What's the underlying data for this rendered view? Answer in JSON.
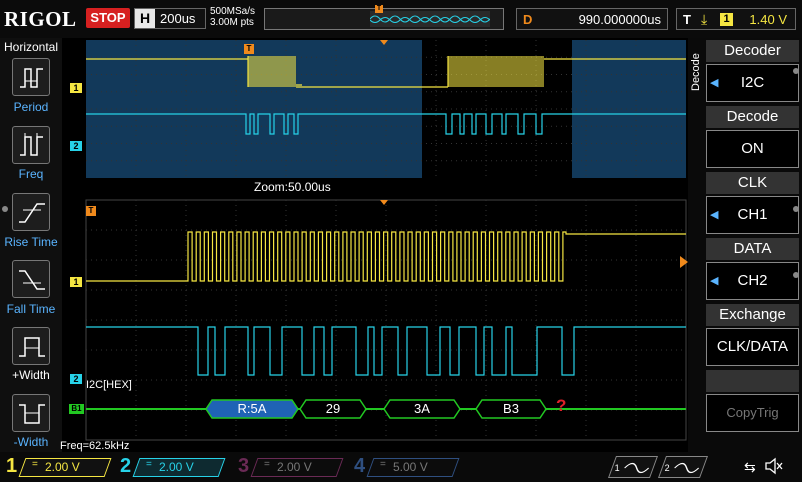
{
  "brand": "RIGOL",
  "run_state": "STOP",
  "timebase": {
    "badge": "H",
    "value": "200us"
  },
  "acquisition": {
    "sample_rate": "500MSa/s",
    "memory": "3.00M pts"
  },
  "delay": {
    "badge": "D",
    "value": "990.000000us"
  },
  "trigger": {
    "badge": "T",
    "edge_symbol": "⤓",
    "source": "1",
    "level": "1.40 V"
  },
  "left_menu": {
    "title": "Horizontal",
    "items": [
      {
        "label": "Period",
        "icon": "period-icon"
      },
      {
        "label": "Freq",
        "icon": "frequency-icon"
      },
      {
        "label": "Rise Time",
        "icon": "rise-time-icon"
      },
      {
        "label": "Fall Time",
        "icon": "fall-time-icon"
      },
      {
        "label": "+Width",
        "icon": "positive-width-icon"
      },
      {
        "label": "-Width",
        "icon": "negative-width-icon"
      }
    ]
  },
  "zoom_label": "Zoom:50.00us",
  "bus_label": "I2C[HEX]",
  "frequency_readout": "Freq=62.5kHz",
  "decoded_packets": [
    "R:5A",
    "29",
    "3A",
    "B3"
  ],
  "decode_error_symbol": "?",
  "markers": {
    "trigger": "T",
    "ch1": "1",
    "ch2": "2",
    "bus": "B1"
  },
  "right_menu": {
    "vertical_title": "Decode",
    "items": [
      {
        "header": "Decoder",
        "value": "I2C",
        "arrow": "◀"
      },
      {
        "header": "Decode",
        "value": "ON",
        "arrow": ""
      },
      {
        "header": "CLK",
        "value": "CH1",
        "arrow": "◀"
      },
      {
        "header": "DATA",
        "value": "CH2",
        "arrow": "◀"
      },
      {
        "header": "Exchange",
        "value": "CLK/DATA",
        "arrow": ""
      },
      {
        "header": "",
        "value": "CopyTrig",
        "arrow": ""
      }
    ]
  },
  "channels": [
    {
      "num": "1",
      "coupling": "=",
      "scale": "2.00 V",
      "color": "#f5e642",
      "active": true
    },
    {
      "num": "2",
      "coupling": "=",
      "scale": "2.00 V",
      "color": "#27d2e8",
      "active": true
    },
    {
      "num": "3",
      "coupling": "=",
      "scale": "2.00 V",
      "color": "#c43d9c",
      "active": false
    },
    {
      "num": "4",
      "coupling": "=",
      "scale": "5.00 V",
      "color": "#2f6fd0",
      "active": false
    }
  ],
  "generators": [
    {
      "label": "1"
    },
    {
      "label": "2"
    }
  ],
  "colors": {
    "accent": "#f08a1c",
    "bus": "#22c822",
    "packet_fill": "#1f63b5",
    "error": "#e0202a"
  }
}
